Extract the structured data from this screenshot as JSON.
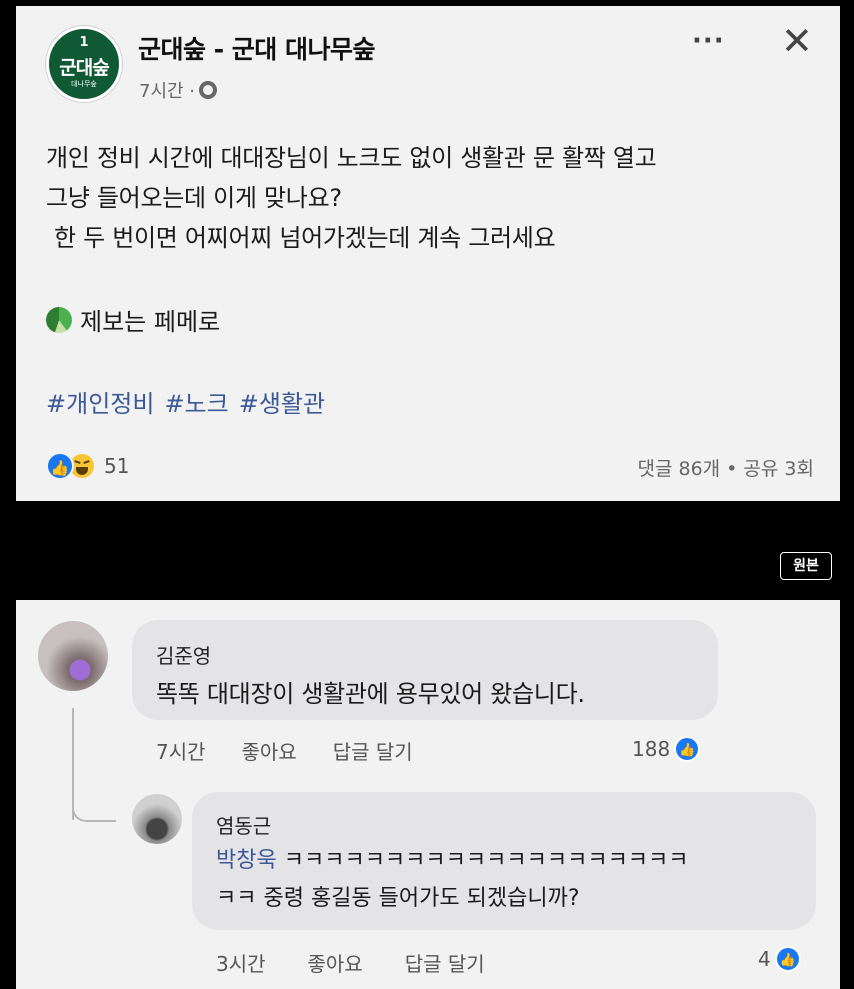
{
  "post": {
    "avatar": {
      "number": "1",
      "name": "군대숲",
      "sub": "대나무숲"
    },
    "page_name": "군대숲 - 군대 대나무숲",
    "time": "7시간 ·",
    "more_label": "···",
    "close_label": "✕",
    "body": {
      "line1": "개인 정비 시간에 대대장님이 노크도 없이 생활관 문 활짝 열고",
      "line2": "그냥 들어오는데 이게 맞나요?",
      "line3": "한 두 번이면 어찌어찌 넘어가겠는데 계속 그러세요"
    },
    "informant": "제보는 페메로",
    "hashtags": [
      "#개인정비",
      "#노크",
      "#생활관"
    ],
    "reaction_count": "51",
    "stats": "댓글 86개 • 공유 3회"
  },
  "badge": {
    "label": "원본"
  },
  "comments": [
    {
      "name": "김준영",
      "text": "똑똑 대대장이 생활관에 용무있어 왔습니다.",
      "time": "7시간",
      "like_label": "좋아요",
      "reply_label": "답글 달기",
      "likes": "188"
    },
    {
      "name": "염동근",
      "mention": "박창욱",
      "text_line1_rest": " ㅋㅋㅋㅋㅋㅋㅋㅋㅋㅋㅋㅋㅋㅋㅋㅋㅋㅋㅋㅋ",
      "text_line2": "ㅋㅋ 중령 홍길동 들어가도 되겠습니까?",
      "time": "3시간",
      "like_label": "좋아요",
      "reply_label": "답글 달기",
      "likes": "4"
    }
  ],
  "icons": {
    "page_avatar": "page-logo-icon",
    "globe": "globe-icon",
    "recycle": "recycle-icon",
    "like": "like-icon",
    "haha": "haha-icon"
  },
  "colors": {
    "like_blue": "#1877f2",
    "hashtag_blue": "#3b5998",
    "page_green": "#0f5a34"
  }
}
